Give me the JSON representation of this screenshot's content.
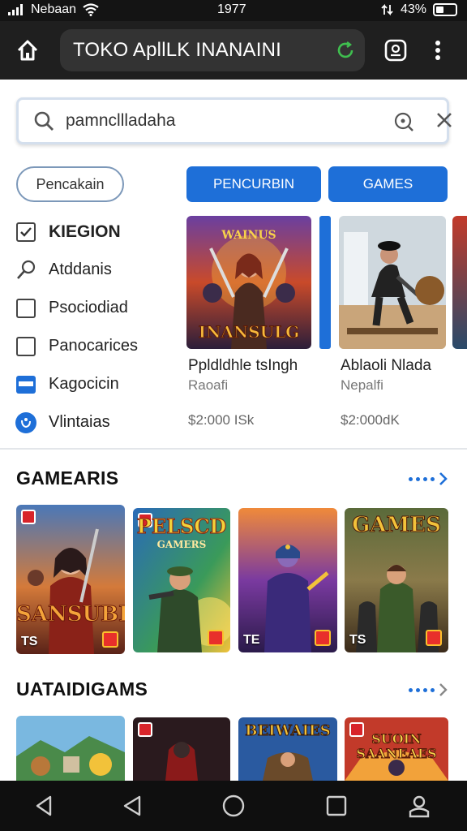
{
  "status_bar": {
    "carrier": "Nebaan",
    "time": "1977",
    "battery": "43%",
    "battery_level": 0.43
  },
  "app_bar": {
    "title": "TOKO ApllLK INANAINI"
  },
  "search": {
    "query": "pamncllladaha"
  },
  "chips": {
    "filter": "Pencakain",
    "primary": "PENCURBIN",
    "games": "GAMES"
  },
  "categories": [
    {
      "label": "KIEGION",
      "icon": "checked-box-icon"
    },
    {
      "label": "Atddanis",
      "icon": "magnifier-icon"
    },
    {
      "label": "Psociodiad",
      "icon": "checkbox-icon"
    },
    {
      "label": "Panocarices",
      "icon": "checkbox-icon"
    },
    {
      "label": "Kagocicin",
      "icon": "window-icon"
    },
    {
      "label": "Vlintaias",
      "icon": "circle-badge-icon"
    }
  ],
  "featured": [
    {
      "art_title": "INANSULG",
      "art_banner": "WAINUS",
      "name": "Ppldldhle tsIngh",
      "sub": "Raoafi",
      "price": "$2:000 ISk"
    },
    {
      "art_title": "",
      "name": "Ablaoli Nlada",
      "sub": "Nepalfi",
      "price": "$2:000dK"
    }
  ],
  "sections": [
    {
      "title": "GAMEARIS",
      "tiles": [
        {
          "title": "SANSUBER",
          "code": "TS"
        },
        {
          "title": "PELSCD",
          "subtitle": "GAMERS",
          "code": ""
        },
        {
          "title": "",
          "code": "TE"
        },
        {
          "title": "GAMES",
          "code": "TS"
        }
      ]
    },
    {
      "title": "UATAIDIGAMS",
      "tiles": [
        {
          "title": ""
        },
        {
          "title": ""
        },
        {
          "title": "BEIWAIES"
        },
        {
          "title": "SUOIN SAANEAES"
        }
      ]
    }
  ],
  "colors": {
    "accent": "#1e6fd8",
    "appbar": "#1f1f1f",
    "status": "#141414"
  }
}
